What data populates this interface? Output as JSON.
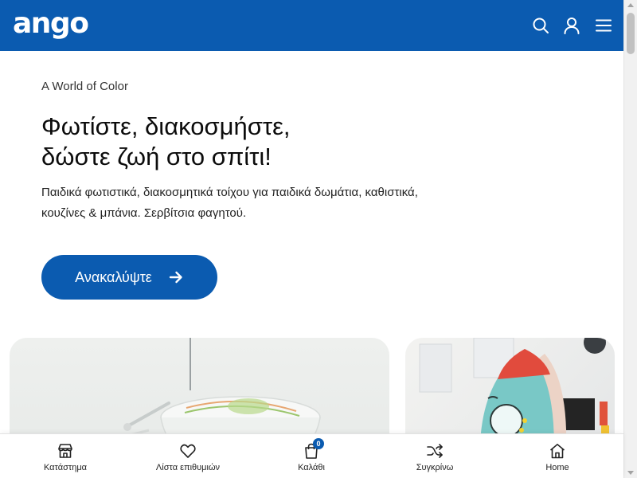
{
  "header": {
    "logo": "ango",
    "icons": [
      "search-icon",
      "user-icon",
      "menu-icon"
    ],
    "brand_color": "#0b5bb0"
  },
  "hero": {
    "eyebrow": "A World of Color",
    "headline_line1": "Φωτίστε, διακοσμήστε,",
    "headline_line2": "δώστε ζωή στο σπίτι!",
    "description": "Παιδικά φωτιστικά, διακοσμητικά τοίχου για παιδικά δωμάτια, καθιστικά, κουζίνες & μπάνια. Σερβίτσια φαγητού.",
    "cta_label": "Ανακαλύψτε"
  },
  "bottom_nav": {
    "items": [
      {
        "label": "Κατάστημα",
        "icon": "store-icon"
      },
      {
        "label": "Λίστα επιθυμιών",
        "icon": "heart-icon"
      },
      {
        "label": "Καλάθι",
        "icon": "shopping-bag-icon",
        "badge": "0"
      },
      {
        "label": "Συγκρίνω",
        "icon": "shuffle-icon"
      },
      {
        "label": "Home",
        "icon": "home-icon"
      }
    ]
  }
}
